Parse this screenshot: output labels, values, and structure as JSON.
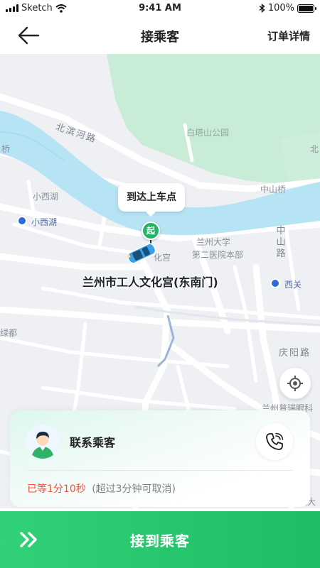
{
  "status_bar": {
    "carrier": "Sketch",
    "time": "9:41 AM",
    "battery": "100%",
    "battery_level": 1.0
  },
  "nav": {
    "title": "接乘客",
    "right_action": "订单详情"
  },
  "map": {
    "labels": {
      "baita_park": "白塔山公园",
      "beibinhe_road": "北滨河路",
      "zhongshan_bridge": "中山桥",
      "xiaoxihu_1": "小西湖",
      "xiaoxihu_2": "小西湖",
      "lanzhou_univ": "兰州大学",
      "second_hospital": "第二医院本部",
      "zhongshan_road": "中山路",
      "xiguan": "西关",
      "lvdu": "绿都",
      "qingyang_road": "庆阳路",
      "putai": "兰州普瑞眼科",
      "bei_partial": "北",
      "qiao_partial": "桥",
      "hua_partial": "化宫",
      "jin_partial": "庆大"
    },
    "pickup_callout": "到达上车点",
    "start_marker": "起",
    "pickup_place": "兰州市工人文化宫(东南门)"
  },
  "passenger_card": {
    "contact_label": "联系乘客",
    "wait_time": "已等1分10秒",
    "wait_note": "(超过3分钟可取消)"
  },
  "action": {
    "label": "接到乘客"
  },
  "colors": {
    "primary_green": "#22b464",
    "warning_red": "#f0503c",
    "water": "#b7e4f5",
    "park": "#c9ecd6"
  },
  "icons": {
    "back": "arrow-left-icon",
    "phone": "phone-icon",
    "locate": "crosshair-icon",
    "swipe": "double-chevron-right-icon",
    "wifi": "wifi-icon",
    "bluetooth": "bluetooth-icon",
    "battery": "battery-icon",
    "car": "car-icon",
    "metro": "metro-icon"
  }
}
